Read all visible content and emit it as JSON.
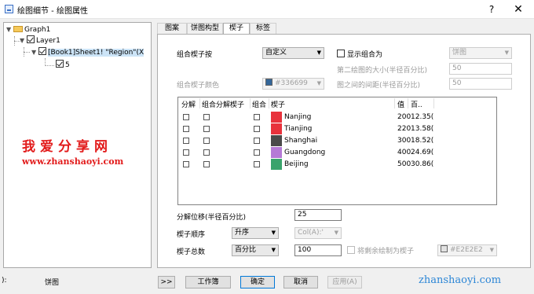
{
  "window": {
    "title": "绘图细节 - 绘图属性",
    "help_label": "?",
    "close_label": "✕"
  },
  "tree": {
    "graph": "Graph1",
    "layer": "Layer1",
    "plot": "[Book1]Sheet1! \"Region\"(X",
    "item": "5"
  },
  "watermark": {
    "text": "我爱分享网",
    "url": "www.zhanshaoyi.com",
    "url_bottom": "zhanshaoyi.com"
  },
  "tabs": [
    "图案",
    "饼图构型",
    "楔子",
    "标签"
  ],
  "wedge": {
    "group_by_label": "组合楔子按",
    "group_by_value": "自定义",
    "show_group_label": "显示组合为",
    "show_group_value": "饼图",
    "second_size_label": "第二绘图的大小(半径百分比)",
    "second_size_value": "50",
    "gap_label": "图之间的间距(半径百分比)",
    "gap_value": "50",
    "color_label": "组合楔子颜色",
    "color_value": "#336699",
    "color_swatch": "#336699"
  },
  "grid": {
    "headers": [
      "分解",
      "组合分解楔子",
      "组合",
      "楔子",
      "值",
      "百.."
    ],
    "rows": [
      {
        "name": "Nanjing",
        "color": "#e8323c",
        "value": "200",
        "percent": "12.35("
      },
      {
        "name": "Tianjing",
        "color": "#e8323c",
        "value": "220",
        "percent": "13.58("
      },
      {
        "name": "Shanghai",
        "color": "#4a4a4a",
        "value": "300",
        "percent": "18.52("
      },
      {
        "name": "Guangdong",
        "color": "#b57ad6",
        "value": "400",
        "percent": "24.69("
      },
      {
        "name": "Beijing",
        "color": "#3aa36c",
        "value": "500",
        "percent": "30.86("
      }
    ]
  },
  "lower": {
    "offset_label": "分解位移(半径百分比)",
    "offset_value": "25",
    "order_label": "楔子顺序",
    "order_value": "升序",
    "order_col_value": "Col(A):'",
    "total_label": "楔子总数",
    "total_mode": "百分比",
    "total_value": "100",
    "remaining_label": "将剩余绘制为楔子",
    "remaining_color": "#E2E2E2"
  },
  "footer": {
    "left_suffix": "):",
    "left_value": "饼图",
    "expand_label": ">>",
    "workbook_label": "工作簿",
    "ok_label": "确定",
    "cancel_label": "取消",
    "apply_label": "应用(A)"
  }
}
